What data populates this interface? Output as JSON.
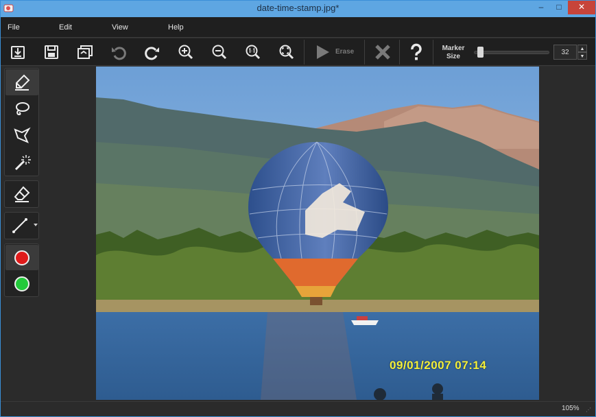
{
  "window": {
    "title": "date-time-stamp.jpg*",
    "min_icon": "minimize-icon",
    "max_icon": "maximize-icon",
    "close_icon": "close-icon",
    "min_glyph": "–",
    "max_glyph": "□",
    "close_glyph": "✕"
  },
  "menu": {
    "file": "File",
    "edit": "Edit",
    "view": "View",
    "help": "Help"
  },
  "toolbar": {
    "icons": [
      "import-icon",
      "save-icon",
      "batch-icon",
      "undo-icon",
      "redo-icon",
      "zoom-in-icon",
      "zoom-out-icon",
      "actual-size-icon",
      "fit-icon",
      "play-icon",
      "cancel-icon",
      "help-icon"
    ],
    "erase_label": "Erase",
    "marker_size_line1": "Marker",
    "marker_size_line2": "Size",
    "marker_size_value": "32",
    "marker_slider_fraction": 0.05,
    "spin_up": "▲",
    "spin_down": "▼"
  },
  "tools": {
    "marker": "marker-icon",
    "lasso": "lasso-icon",
    "polygon_lasso": "polygon-lasso-icon",
    "magic_wand": "magic-wand-icon",
    "eraser": "eraser-icon",
    "line": "line-tool-icon",
    "red_color": "#e01b1b",
    "green_color": "#22c93a"
  },
  "canvas": {
    "date_stamp": "09/01/2007 07:14"
  },
  "status": {
    "zoom": "105%",
    "grip": "⋰"
  },
  "colors": {
    "titlebar": "#5ea6e2",
    "accent_close": "#c7443a"
  }
}
